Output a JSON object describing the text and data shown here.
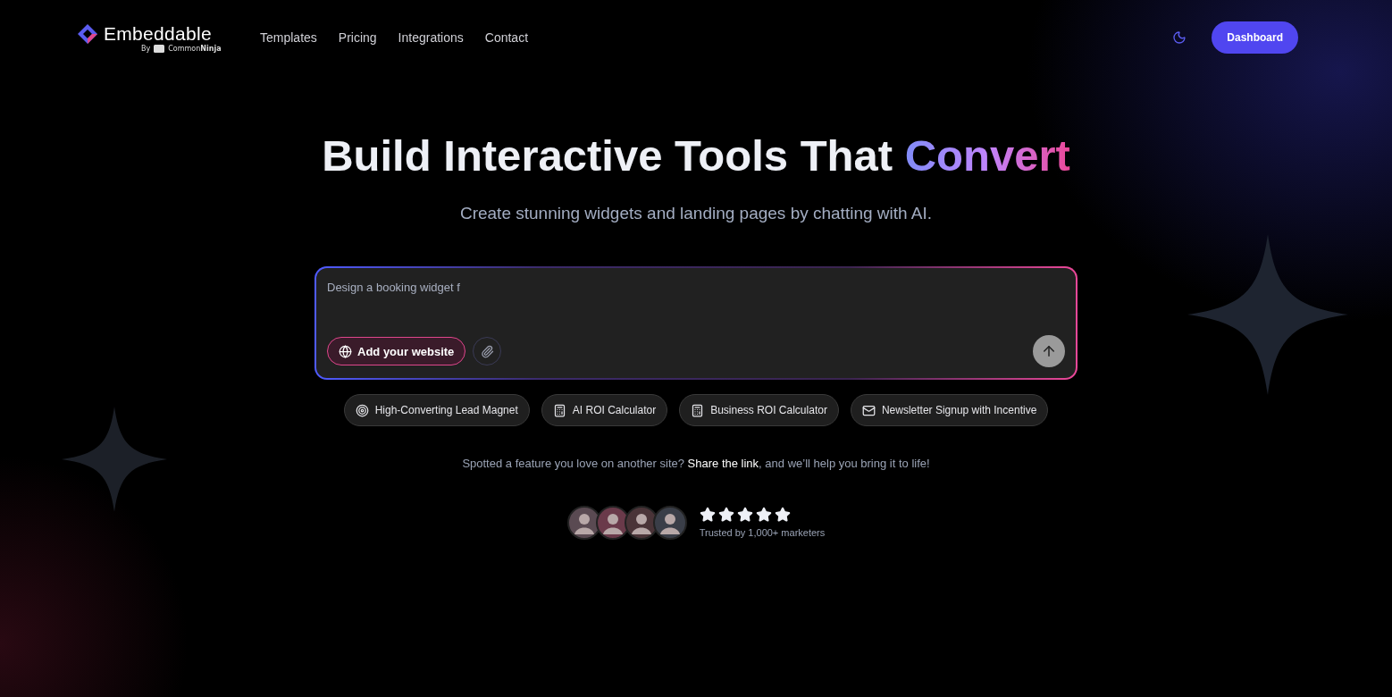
{
  "brand": {
    "name": "Embeddable",
    "by": "By",
    "partner": "Common**Ninja**"
  },
  "nav": [
    {
      "label": "Templates"
    },
    {
      "label": "Pricing"
    },
    {
      "label": "Integrations"
    },
    {
      "label": "Contact"
    }
  ],
  "dashboard_button": "Dashboard",
  "hero": {
    "title": "Build Interactive Tools That ",
    "title_highlight": "Convert",
    "subtitle": "Create stunning widgets and landing pages by chatting with AI."
  },
  "prompt": {
    "value": "Design a booking widget f",
    "website_button": "Add your website"
  },
  "suggestions": [
    {
      "kind": "target",
      "label": "High-Converting Lead Magnet"
    },
    {
      "kind": "calculator",
      "label": "AI ROI Calculator"
    },
    {
      "kind": "calculator",
      "label": "Business ROI Calculator"
    },
    {
      "kind": "mail",
      "label": "Newsletter Signup with Incentive"
    }
  ],
  "share": {
    "before": "Spotted a feature you love on another site? ",
    "link": "Share the link",
    "after": ", and we’ll help you bring it to life!"
  },
  "social_proof": {
    "avatars": [
      {
        "kind": "avatar"
      },
      {
        "kind": "avatar"
      },
      {
        "kind": "avatar"
      },
      {
        "kind": "avatar"
      }
    ],
    "stars": 5,
    "caption": "Trusted by 1,000+ marketers"
  }
}
